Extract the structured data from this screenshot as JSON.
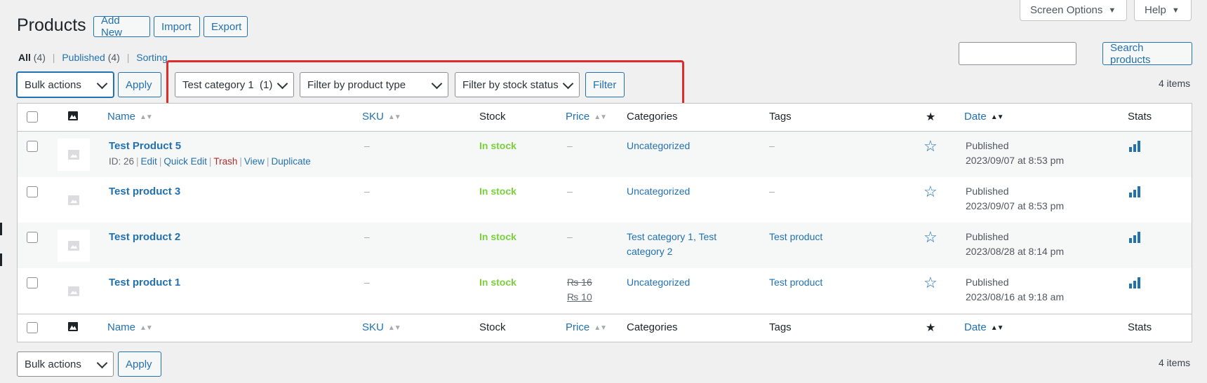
{
  "header": {
    "screen_options": "Screen Options",
    "help": "Help",
    "title": "Products",
    "add_new": "Add New",
    "import": "Import",
    "export": "Export"
  },
  "views": {
    "all": "All",
    "all_count": "(4)",
    "published": "Published",
    "published_count": "(4)",
    "sorting": "Sorting"
  },
  "search": {
    "button": "Search products",
    "value": ""
  },
  "tablenav_top": {
    "bulk_actions": "Bulk actions",
    "apply": "Apply",
    "category_filter": "Test category 1  (1)",
    "type_filter": "Filter by product type",
    "stock_filter": "Filter by stock status",
    "filter_button": "Filter",
    "items": "4 items"
  },
  "columns": {
    "name": "Name",
    "sku": "SKU",
    "stock": "Stock",
    "price": "Price",
    "categories": "Categories",
    "tags": "Tags",
    "date": "Date",
    "stats": "Stats"
  },
  "rows": [
    {
      "name": "Test Product 5",
      "id_label": "ID: 26",
      "actions": {
        "edit": "Edit",
        "quick_edit": "Quick Edit",
        "trash": "Trash",
        "view": "View",
        "duplicate": "Duplicate"
      },
      "sku": "–",
      "stock": "In stock",
      "price": "–",
      "categories": "Uncategorized",
      "tags": "–",
      "date_status": "Published",
      "date": "2023/09/07 at 8:53 pm"
    },
    {
      "name": "Test product 3",
      "sku": "–",
      "stock": "In stock",
      "price": "–",
      "categories": "Uncategorized",
      "tags": "–",
      "date_status": "Published",
      "date": "2023/09/07 at 8:53 pm"
    },
    {
      "name": "Test product 2",
      "sku": "–",
      "stock": "In stock",
      "price": "–",
      "categories_line1": "Test category 1, Test",
      "categories_line2": "category 2",
      "tags": "Test product",
      "date_status": "Published",
      "date": "2023/08/28 at 8:14 pm"
    },
    {
      "name": "Test product 1",
      "sku": "–",
      "stock": "In stock",
      "price_regular": "₨ 16",
      "price_sale": "₨ 10",
      "categories": "Uncategorized",
      "tags": "Test product",
      "date_status": "Published",
      "date": "2023/08/16 at 9:18 am"
    }
  ],
  "tablenav_bottom": {
    "bulk_actions": "Bulk actions",
    "apply": "Apply",
    "items": "4 items"
  },
  "colors": {
    "link": "#2271b1",
    "in_stock": "#7ad03a",
    "trash": "#b32d2e",
    "highlight_box": "#e02b2b"
  }
}
